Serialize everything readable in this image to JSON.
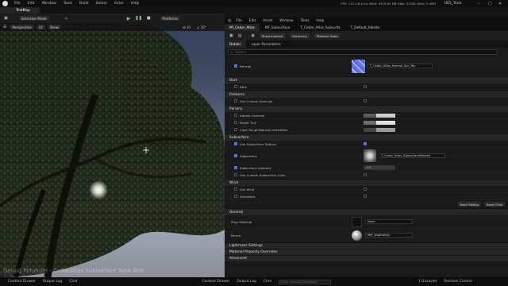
{
  "menubar": {
    "items": [
      "File",
      "Edit",
      "Window",
      "Tools",
      "Build",
      "Select",
      "Actor",
      "Help"
    ],
    "stats": "FPS: 115.3   8.4 ms   Mem: 9319.82 MB   Objs: 47184   Verts: 5.38M",
    "project": "UE5_Train"
  },
  "level_tab": "TestMap",
  "main_toolbar": {
    "selection_mode": "Selection Mode",
    "platforms": "Platforms"
  },
  "viewport": {
    "perspective": "Perspective",
    "lit": "Lit",
    "show": "Show",
    "watermark": "Gerald Pimentel - CedarAtlas Subsurface Type Test"
  },
  "editor": {
    "menu": [
      "File",
      "Edit",
      "Asset",
      "Window",
      "Tools",
      "Help"
    ],
    "tabs": [
      "MI_Cedar_Atlas",
      "MF_Subsurface",
      "T_Cedar_Atlas_Subsurfa",
      "T_Default_Albedo"
    ],
    "toolbar": {
      "show_inactive": "Show Inactive",
      "hierarchy": "Hierarchy",
      "platform_stats": "Platform Stats"
    },
    "panel_tabs": [
      "Details",
      "Layer Parameters"
    ],
    "search_placeholder": "Search",
    "normal": {
      "label": "Normal",
      "texture": "T_Cedar_Atlas_Normal_Spr_Tex"
    },
    "sections": {
      "bark": {
        "title": "Bark",
        "props": [
          "Bark"
        ]
      },
      "features": {
        "title": "Features",
        "props": [
          "Use Custom Specular"
        ]
      },
      "params": {
        "title": "Params",
        "props": [
          "Albedo Contrast",
          "Bright Tint",
          "Color Rough/Normal Intensities"
        ]
      },
      "subsurface": {
        "title": "Subsurface",
        "props": [
          "Use Subsurface Texture",
          "Subsurface",
          "Subsurface Intensity",
          "Use Custom Subsurface Color"
        ],
        "texture": "T_Cedar_Atlas_SubsurfaceMasked",
        "intensity": "1.0"
      },
      "wind": {
        "title": "Wind",
        "props": [
          "Use Wind",
          "Windward"
        ]
      },
      "general": {
        "title": "General",
        "phys_label": "Phys Material",
        "phys_value": "None",
        "parent_label": "Parent",
        "parent_value": "MM_Vegetation"
      }
    },
    "save_sibling": "Save Sibling",
    "save_child": "Save Child",
    "collapsed": [
      "Lightmass Settings",
      "Material Property Overrides",
      "Advanced"
    ]
  },
  "status": {
    "left": [
      "Content Drawer",
      "Output Log",
      "Cmd"
    ],
    "right": [
      "Content Drawer",
      "Output Log",
      "Cmd"
    ],
    "console_placeholder": "Enter Console Command",
    "unsaved": "1 Unsaved",
    "revision": "Revision Control"
  }
}
